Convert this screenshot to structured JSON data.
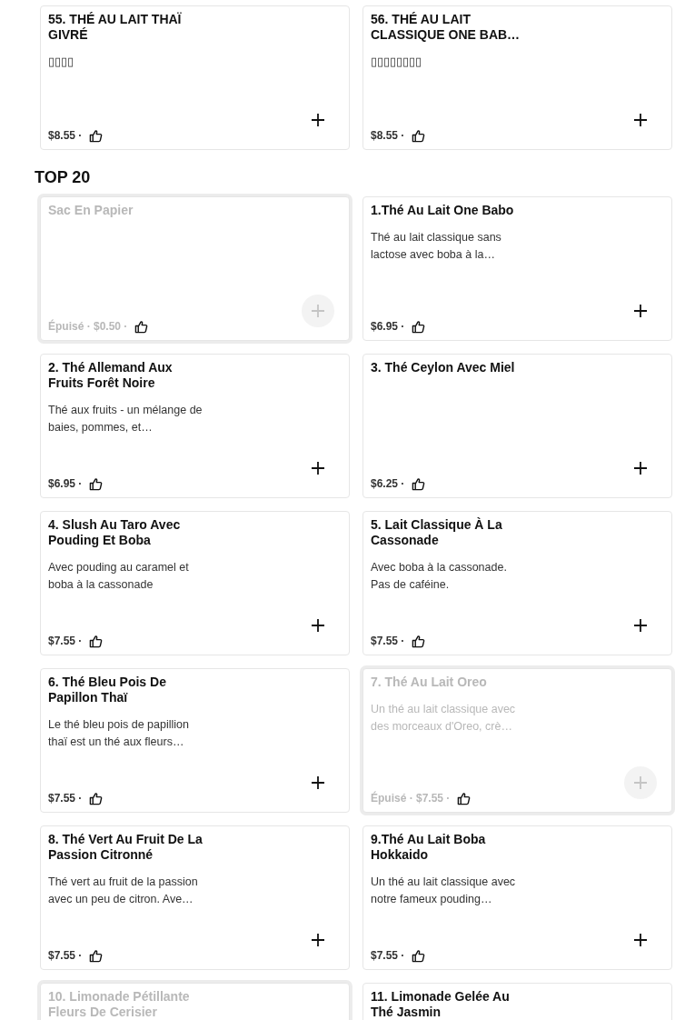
{
  "items": [
    {
      "title": "55. THÉ AU LAIT THAÏ GIVRÉ",
      "description": "▯▯▯▯",
      "price_line": "$8.55 ·",
      "sold_out": false
    },
    {
      "title": "56. THÉ AU LAIT CLASSIQUE ONE BAB…",
      "description": "▯▯▯▯▯▯▯▯",
      "price_line": "$8.55 ·",
      "sold_out": false
    }
  ],
  "sections": [
    {
      "title": "TOP 20",
      "items": [
        {
          "title": "Sac En Papier",
          "price_line": "Épuisé · $0.50 ·",
          "sold_out": true
        },
        {
          "title": "1.Thé Au Lait One Babo",
          "description": "Thé au lait classique sans lactose avec boba à la…",
          "price_line": "$6.95 ·",
          "sold_out": false
        },
        {
          "title": "2. Thé Allemand Aux Fruits Forêt Noire",
          "description": "Thé aux fruits - un mélange de baies, pommes, et…",
          "price_line": "$6.95 ·",
          "sold_out": false
        },
        {
          "title": "3. Thé Ceylon Avec Miel",
          "price_line": "$6.25 ·",
          "sold_out": false
        },
        {
          "title": "4. Slush Au Taro Avec Pouding Et Boba",
          "description": "Avec pouding au caramel et boba à la cassonade",
          "price_line": "$7.55 ·",
          "sold_out": false
        },
        {
          "title": "5. Lait Classique À La Cassonade",
          "description": "Avec boba à la cassonade. Pas de caféine.",
          "price_line": "$7.55 ·",
          "sold_out": false
        },
        {
          "title": "6. Thé Bleu Pois De Papillon Thaï",
          "description": "Le thé bleu pois de papillion thaï est un thé aux fleurs…",
          "price_line": "$7.55 ·",
          "sold_out": false
        },
        {
          "title": "7. Thé Au Lait Oreo",
          "description": "Un thé au lait classique avec des morceaux d'Oreo, crè…",
          "price_line": "Épuisé · $7.55 ·",
          "sold_out": true
        },
        {
          "title": "8. Thé Vert Au Fruit De La Passion Citronné",
          "description": "Thé vert au fruit de la passion avec un peu de citron. Ave…",
          "price_line": "$7.55 ·",
          "sold_out": false
        },
        {
          "title": "9.Thé Au Lait Boba Hokkaido",
          "description": "Un thé au lait classique avec notre fameux pouding…",
          "price_line": "$7.55 ·",
          "sold_out": false
        },
        {
          "title": "10. Limonade Pétillante Fleurs De Cerisier",
          "sold_out": true
        },
        {
          "title": "11. Limonade Gelée Au Thé Jasmin",
          "sold_out": false
        }
      ]
    }
  ]
}
